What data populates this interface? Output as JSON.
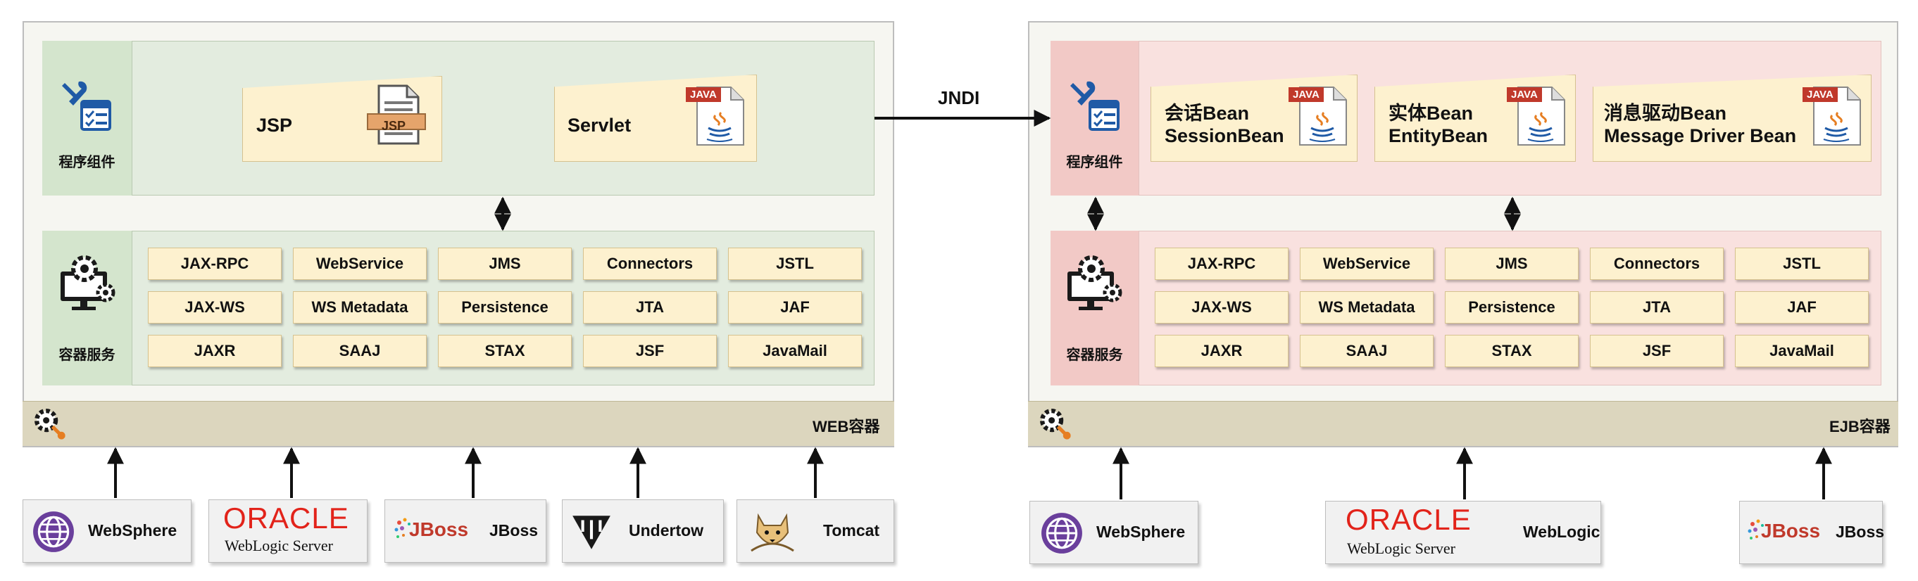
{
  "web": {
    "component_label": "程序组件",
    "service_label": "容器服务",
    "container_label": "WEB容器",
    "components": [
      {
        "label": "JSP",
        "icon_text": "JSP"
      },
      {
        "label": "Servlet",
        "icon_text": "JAVA"
      }
    ],
    "services": [
      "JAX-RPC",
      "WebService",
      "JMS",
      "Connectors",
      "JSTL",
      "JAX-WS",
      "WS Metadata",
      "Persistence",
      "JTA",
      "JAF",
      "JAXR",
      "SAAJ",
      "STAX",
      "JSF",
      "JavaMail"
    ],
    "servers": [
      {
        "name": "WebSphere"
      },
      {
        "oracle": "ORACLE",
        "sub": "WebLogic Server"
      },
      {
        "logo": "JBoss",
        "name": "JBoss"
      },
      {
        "name": "Undertow"
      },
      {
        "name": "Tomcat"
      }
    ]
  },
  "jndi": "JNDI",
  "ejb": {
    "component_label": "程序组件",
    "service_label": "容器服务",
    "container_label": "EJB容器",
    "components": [
      {
        "line1": "会话Bean",
        "line2": "SessionBean",
        "icon_text": "JAVA"
      },
      {
        "line1": "实体Bean",
        "line2": "EntityBean",
        "icon_text": "JAVA"
      },
      {
        "line1": "消息驱动Bean",
        "line2": "Message Driver Bean",
        "icon_text": "JAVA"
      }
    ],
    "services": [
      "JAX-RPC",
      "WebService",
      "JMS",
      "Connectors",
      "JSTL",
      "JAX-WS",
      "WS Metadata",
      "Persistence",
      "JTA",
      "JAF",
      "JAXR",
      "SAAJ",
      "STAX",
      "JSF",
      "JavaMail"
    ],
    "servers": [
      {
        "name": "WebSphere"
      },
      {
        "oracle": "ORACLE",
        "sub": "WebLogic Server",
        "name": "WebLogic"
      },
      {
        "logo": "JBoss",
        "name": "JBoss"
      }
    ]
  },
  "colors": {
    "green_panel": "#e3ecdf",
    "pink_panel": "#f9e1df",
    "tag": "#fdf1cf",
    "icon_blue": "#1f5aa6",
    "java_red": "#c0392b"
  }
}
